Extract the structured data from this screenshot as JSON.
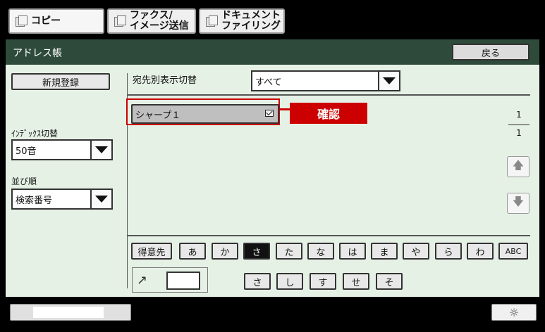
{
  "tabs": [
    {
      "label": "コピー"
    },
    {
      "label": "ファクス/\nイメージ送信"
    },
    {
      "label": "ドキュメント\nファイリング"
    }
  ],
  "header": {
    "title": "アドレス帳",
    "back_label": "戻る"
  },
  "left": {
    "new_register_label": "新規登録",
    "index_label": "ｲﾝﾃﾞｯｸｽ切替",
    "index_value": "50音",
    "sort_label": "並び順",
    "sort_value": "検索番号"
  },
  "main": {
    "filter_label": "宛先別表示切替",
    "filter_value": "すべて",
    "entry_label": "シャープ１",
    "callout_label": "確認",
    "page_current": "1",
    "page_total": "1"
  },
  "index_keys": [
    "得意先",
    "あ",
    "か",
    "さ",
    "た",
    "な",
    "は",
    "ま",
    "や",
    "ら",
    "わ",
    "ABC"
  ],
  "active_index": "さ",
  "sub_keys": [
    "さ",
    "し",
    "す",
    "せ",
    "そ"
  ],
  "icons": {
    "back": "arrow-icon",
    "up": "up-arrow-icon",
    "down": "down-arrow-icon",
    "brightness": "sun-icon"
  },
  "colors": {
    "titlebar": "#2e4a3a",
    "panel": "#e6f1e6",
    "callout": "#cc0000",
    "active_key": "#111111"
  }
}
